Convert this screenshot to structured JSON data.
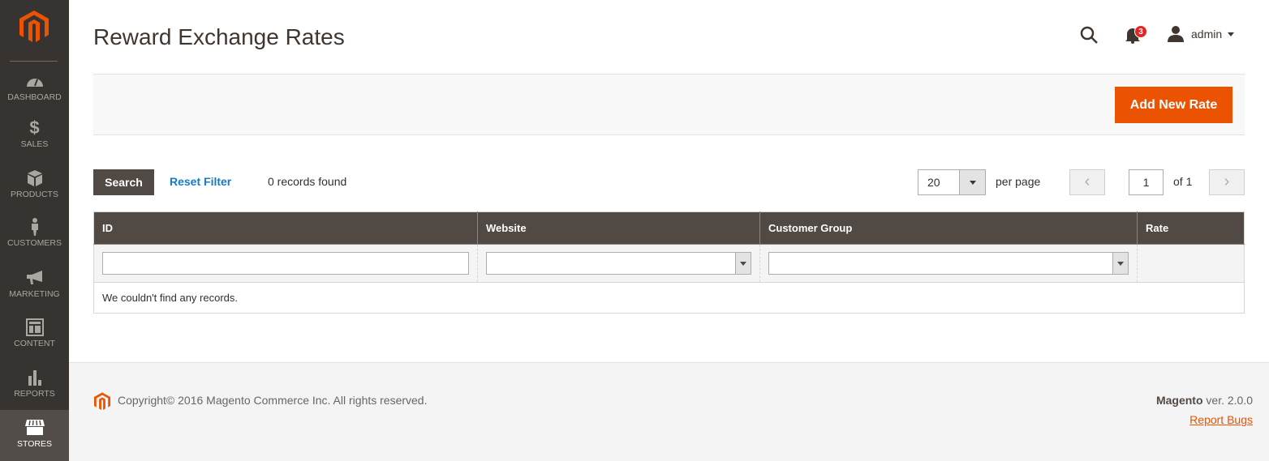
{
  "sidebar": {
    "logo": "magento-logo",
    "items": [
      {
        "label": "DASHBOARD",
        "icon": "dashboard-icon",
        "active": false
      },
      {
        "label": "SALES",
        "icon": "dollar-icon",
        "active": false
      },
      {
        "label": "PRODUCTS",
        "icon": "box-icon",
        "active": false
      },
      {
        "label": "CUSTOMERS",
        "icon": "person-icon",
        "active": false
      },
      {
        "label": "MARKETING",
        "icon": "megaphone-icon",
        "active": false
      },
      {
        "label": "CONTENT",
        "icon": "layout-icon",
        "active": false
      },
      {
        "label": "REPORTS",
        "icon": "bar-chart-icon",
        "active": false
      },
      {
        "label": "STORES",
        "icon": "storefront-icon",
        "active": true
      }
    ]
  },
  "header": {
    "title": "Reward Exchange Rates",
    "notifications_count": "3",
    "username": "admin"
  },
  "actions": {
    "add_button": "Add New Rate"
  },
  "toolbar": {
    "search_button": "Search",
    "reset_filter": "Reset Filter",
    "records_found": "0 records found",
    "per_page_value": "20",
    "per_page_label": "per page",
    "prev_glyph": "‹",
    "next_glyph": "›",
    "current_page": "1",
    "total_pages_label": "of 1"
  },
  "grid": {
    "columns": [
      "ID",
      "Website",
      "Customer Group",
      "Rate"
    ],
    "filters": {
      "id_value": "",
      "website_value": "",
      "customer_group_value": ""
    },
    "empty_message": "We couldn't find any records."
  },
  "footer": {
    "copyright": "Copyright© 2016 Magento Commerce Inc. All rights reserved.",
    "brand": "Magento",
    "version": " ver. 2.0.0",
    "report_bugs": "Report Bugs"
  },
  "colors": {
    "brand_orange": "#eb5202",
    "sidebar_bg": "#373330",
    "grid_header_bg": "#514943",
    "link_blue": "#1979c3",
    "badge_red": "#e22626"
  }
}
